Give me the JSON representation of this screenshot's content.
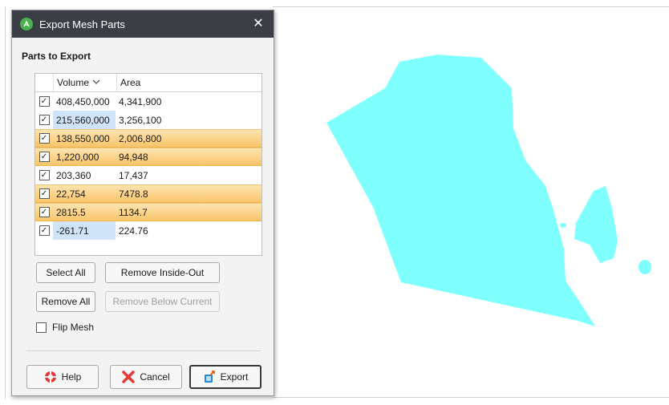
{
  "dialog": {
    "title": "Export Mesh Parts",
    "close_glyph": "✕",
    "section_label": "Parts to Export"
  },
  "table": {
    "columns": [
      "",
      "Volume",
      "Area"
    ],
    "sort_column": "Volume",
    "sort_icon": "chevron-down-icon",
    "rows": [
      {
        "checked": true,
        "volume": "408,450,000",
        "area": "4,341,900",
        "highlighted": false,
        "volume_selected": false
      },
      {
        "checked": true,
        "volume": "215,560,000",
        "area": "3,256,100",
        "highlighted": false,
        "volume_selected": true
      },
      {
        "checked": true,
        "volume": "138,550,000",
        "area": "2,006,800",
        "highlighted": true,
        "volume_selected": false
      },
      {
        "checked": true,
        "volume": "1,220,000",
        "area": "94,948",
        "highlighted": true,
        "volume_selected": false
      },
      {
        "checked": true,
        "volume": "203,360",
        "area": "17,437",
        "highlighted": false,
        "volume_selected": false
      },
      {
        "checked": true,
        "volume": "22,754",
        "area": "7478.8",
        "highlighted": true,
        "volume_selected": false
      },
      {
        "checked": true,
        "volume": "2815.5",
        "area": "1134.7",
        "highlighted": true,
        "volume_selected": false
      },
      {
        "checked": true,
        "volume": "-261.71",
        "area": "224.76",
        "highlighted": false,
        "volume_selected": true
      }
    ]
  },
  "buttons": {
    "select_all": "Select All",
    "remove_inside_out": "Remove Inside-Out",
    "remove_all": "Remove All",
    "remove_below_current": "Remove Below Current",
    "help": "Help",
    "cancel": "Cancel",
    "export": "Export"
  },
  "flip_mesh": {
    "label": "Flip Mesh",
    "checked": false
  },
  "colors": {
    "mesh": "#80ffff",
    "titlebar": "#3b3f45",
    "highlight": "#f9c56b",
    "selection": "#cfe3f9"
  }
}
